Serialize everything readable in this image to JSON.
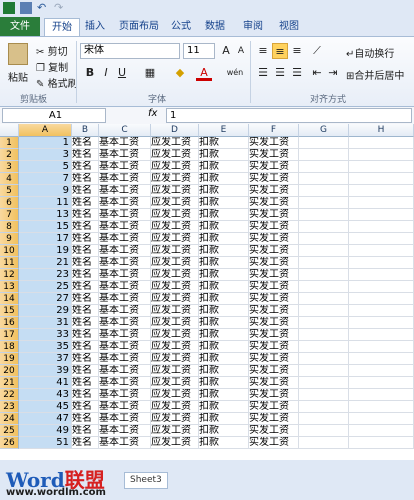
{
  "ribbon_tabs": [
    "文件",
    "开始",
    "插入",
    "页面布局",
    "公式",
    "数据",
    "审阅",
    "视图"
  ],
  "clipboard": {
    "paste": "粘贴",
    "cut": "剪切",
    "copy": "复制",
    "format_painter": "格式刷",
    "label": "剪贴板"
  },
  "font": {
    "name": "宋体",
    "size": "11",
    "bold": "B",
    "italic": "I",
    "underline": "U",
    "color_letter": "A",
    "wen": "wén",
    "label": "字体"
  },
  "alignment": {
    "wrap": "自动换行",
    "merge": "合并后居中",
    "label": "对齐方式"
  },
  "formula_bar": {
    "name_box": "A1",
    "fx": "fx",
    "value": "1"
  },
  "columns": [
    "A",
    "B",
    "C",
    "D",
    "E",
    "F",
    "G",
    "H"
  ],
  "rows": [
    {
      "n": "1",
      "a": "1"
    },
    {
      "n": "2",
      "a": "3"
    },
    {
      "n": "3",
      "a": "5"
    },
    {
      "n": "4",
      "a": "7"
    },
    {
      "n": "5",
      "a": "9"
    },
    {
      "n": "6",
      "a": "11"
    },
    {
      "n": "7",
      "a": "13"
    },
    {
      "n": "8",
      "a": "15"
    },
    {
      "n": "9",
      "a": "17"
    },
    {
      "n": "10",
      "a": "19"
    },
    {
      "n": "11",
      "a": "21"
    },
    {
      "n": "12",
      "a": "23"
    },
    {
      "n": "13",
      "a": "25"
    },
    {
      "n": "14",
      "a": "27"
    },
    {
      "n": "15",
      "a": "29"
    },
    {
      "n": "16",
      "a": "31"
    },
    {
      "n": "17",
      "a": "33"
    },
    {
      "n": "18",
      "a": "35"
    },
    {
      "n": "19",
      "a": "37"
    },
    {
      "n": "20",
      "a": "39"
    },
    {
      "n": "21",
      "a": "41"
    },
    {
      "n": "22",
      "a": "43"
    },
    {
      "n": "23",
      "a": "45"
    },
    {
      "n": "24",
      "a": "47"
    },
    {
      "n": "25",
      "a": "49"
    },
    {
      "n": "26",
      "a": "51"
    }
  ],
  "row_text": {
    "b": "姓名",
    "c": "基本工资",
    "d": "应发工资",
    "e": "扣款",
    "f": "实发工资"
  },
  "sheet_tabs": [
    "Sheet3"
  ],
  "watermark": {
    "logo_word": "Word",
    "logo_cn": "联盟",
    "url": "www.wordlm.com"
  }
}
